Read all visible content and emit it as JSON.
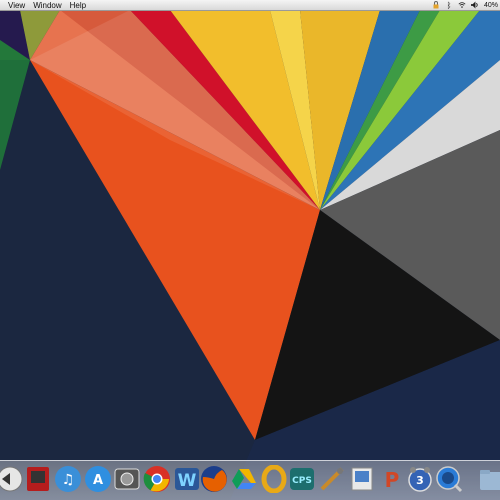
{
  "menubar": {
    "items": [
      "View",
      "Window",
      "Help"
    ],
    "battery": "40%"
  },
  "dock": {
    "apps": [
      {
        "name": "Reeder"
      },
      {
        "name": "Photo Booth"
      },
      {
        "name": "iTunes"
      },
      {
        "name": "App Store"
      },
      {
        "name": "Image Capture"
      },
      {
        "name": "Google Chrome"
      },
      {
        "name": "Word"
      },
      {
        "name": "Firefox"
      },
      {
        "name": "Google Drive"
      },
      {
        "name": "Outlook"
      },
      {
        "name": "Creative Cloud"
      },
      {
        "name": "Xcode Instruments"
      },
      {
        "name": "Preview"
      },
      {
        "name": "PowerPoint"
      },
      {
        "name": "Calendar Alarm",
        "badge": "3"
      },
      {
        "name": "QuickTime"
      },
      {
        "name": "Folder"
      }
    ]
  },
  "colors": {
    "navy": "#1b2740",
    "orange": "#e8521e",
    "yellow": "#f2be2c",
    "red": "#d0112a",
    "blue": "#2a6fae",
    "green": "#4ab33c",
    "gray": "#5a5a5a",
    "black": "#141414"
  }
}
